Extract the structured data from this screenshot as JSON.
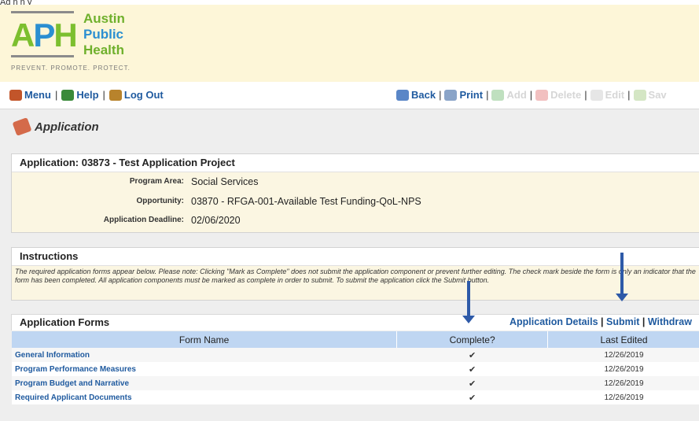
{
  "top_cut_text": "Ag n              n                  y",
  "brand": {
    "letters": [
      "A",
      "P",
      "H"
    ],
    "words": [
      "Austin",
      "Public",
      "Health"
    ],
    "tagline": "PREVENT. PROMOTE. PROTECT."
  },
  "toolbar": {
    "menu": "Menu",
    "help": "Help",
    "logout": "Log Out",
    "back": "Back",
    "print": "Print",
    "add": "Add",
    "delete": "Delete",
    "edit": "Edit",
    "save": "Sav",
    "sep": "|"
  },
  "page_title": "Application",
  "application_panel": {
    "header": "Application: 03873 - Test Application Project",
    "program_area_label": "Program Area:",
    "program_area": "Social Services",
    "opportunity_label": "Opportunity:",
    "opportunity": "03870 - RFGA-001-Available Test Funding-QoL-NPS",
    "deadline_label": "Application Deadline:",
    "deadline": "02/06/2020"
  },
  "instructions": {
    "header": "Instructions",
    "text": "The required application forms appear below. Please note: Clicking \"Mark as Complete\" does not submit the application component or prevent further editing. The check mark beside the form is only an indicator that the form has been completed. All application components must be marked as complete in order to submit. To submit the application click the Submit button."
  },
  "forms": {
    "header": "Application Forms",
    "actions": [
      "Application Details",
      "Submit",
      "Withdraw"
    ],
    "columns": [
      "Form Name",
      "Complete?",
      "Last Edited"
    ],
    "rows": [
      {
        "name": "General Information",
        "complete": "✔",
        "edited": "12/26/2019"
      },
      {
        "name": "Program Performance Measures",
        "complete": "✔",
        "edited": "12/26/2019"
      },
      {
        "name": "Program Budget and Narrative",
        "complete": "✔",
        "edited": "12/26/2019"
      },
      {
        "name": "Required Applicant Documents",
        "complete": "✔",
        "edited": "12/26/2019"
      }
    ]
  },
  "colors": {
    "link": "#1f5a9f",
    "brand_green": "#7cbf2f",
    "brand_blue": "#2b8fd1",
    "table_header": "#bfd6f2",
    "arrow": "#2e5aa8"
  }
}
